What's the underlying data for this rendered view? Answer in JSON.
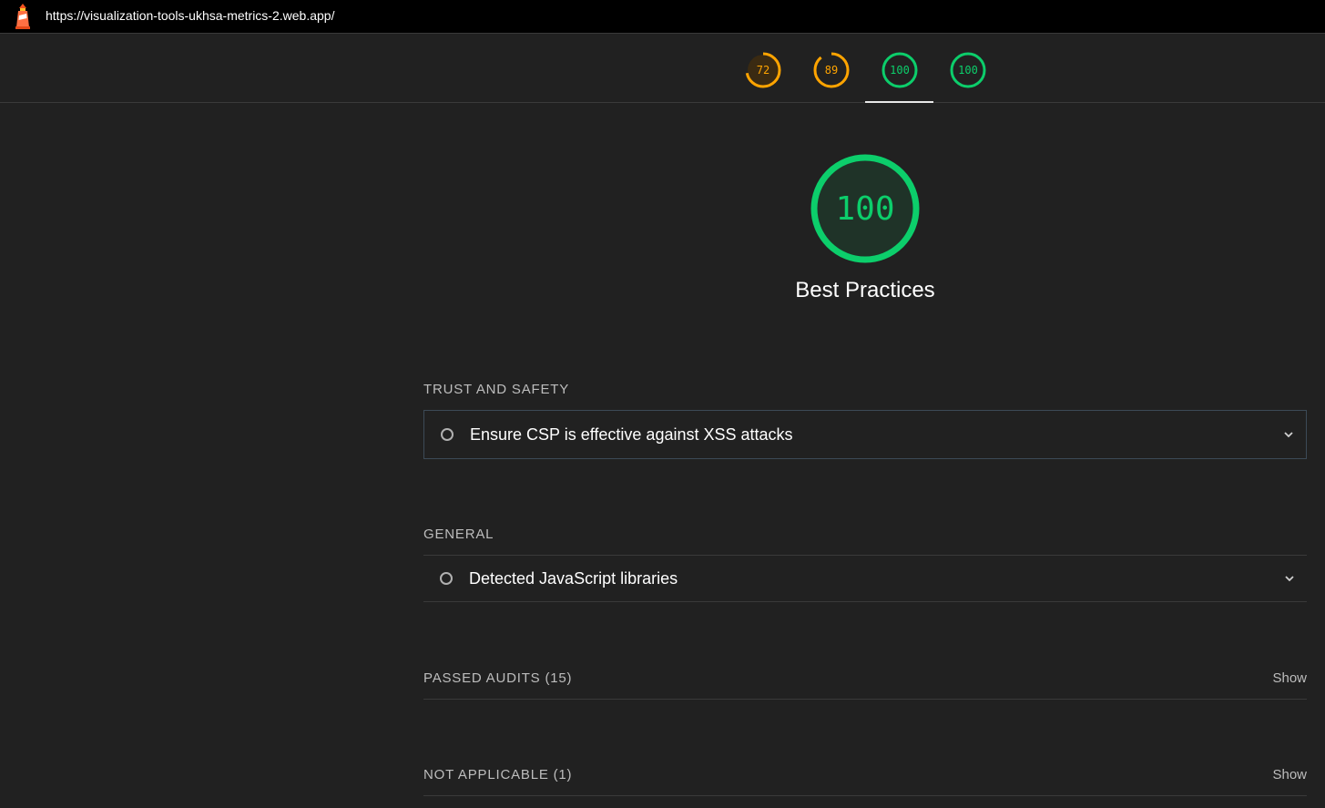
{
  "header": {
    "url": "https://visualization-tools-ukhsa-metrics-2.web.app/",
    "logo_icon": "lighthouse-icon"
  },
  "gauges": [
    {
      "score": "72",
      "fraction": 0.72,
      "color": "#ffa400",
      "bg": "#3a2a12"
    },
    {
      "score": "89",
      "fraction": 0.89,
      "color": "#ffa400",
      "bg": "#212121"
    },
    {
      "score": "100",
      "fraction": 1.0,
      "color": "#0cce6b",
      "bg": "#212121"
    },
    {
      "score": "100",
      "fraction": 1.0,
      "color": "#0cce6b",
      "bg": "#212121"
    }
  ],
  "category": {
    "score": "100",
    "title": "Best Practices",
    "color": "#0cce6b"
  },
  "groups": {
    "trust_safety": {
      "title": "TRUST AND SAFETY",
      "audit": "Ensure CSP is effective against XSS attacks"
    },
    "general": {
      "title": "GENERAL",
      "audit": "Detected JavaScript libraries"
    },
    "passed": {
      "title": "PASSED AUDITS (15)",
      "action": "Show"
    },
    "not_applicable": {
      "title": "NOT APPLICABLE (1)",
      "action": "Show"
    }
  }
}
